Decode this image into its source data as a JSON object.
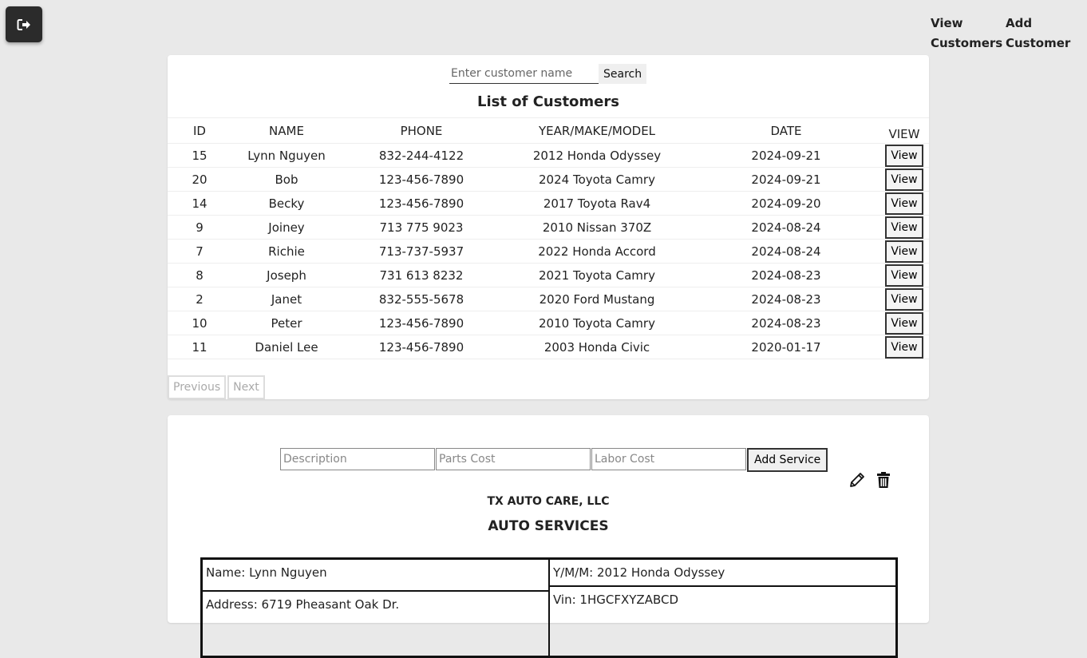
{
  "nav": {
    "view_customers": [
      "View",
      "Customers"
    ],
    "add_customer": [
      "Add",
      "Customer"
    ]
  },
  "search": {
    "placeholder": "Enter customer name",
    "button": "Search"
  },
  "list_title": "List of Customers",
  "table": {
    "headers": [
      "ID",
      "NAME",
      "PHONE",
      "YEAR/MAKE/MODEL",
      "DATE",
      "VIEW"
    ],
    "view_label": "View",
    "rows": [
      {
        "id": "15",
        "name": "Lynn Nguyen",
        "phone": "832-244-4122",
        "vehicle": "2012 Honda Odyssey",
        "date": "2024-09-21"
      },
      {
        "id": "20",
        "name": "Bob",
        "phone": "123-456-7890",
        "vehicle": "2024 Toyota Camry",
        "date": "2024-09-21"
      },
      {
        "id": "14",
        "name": "Becky",
        "phone": "123-456-7890",
        "vehicle": "2017 Toyota Rav4",
        "date": "2024-09-20"
      },
      {
        "id": "9",
        "name": "Joiney",
        "phone": "713 775 9023",
        "vehicle": "2010 Nissan 370Z",
        "date": "2024-08-24"
      },
      {
        "id": "7",
        "name": "Richie",
        "phone": "713-737-5937",
        "vehicle": "2022 Honda Accord",
        "date": "2024-08-24"
      },
      {
        "id": "8",
        "name": "Joseph",
        "phone": "731 613 8232",
        "vehicle": "2021 Toyota Camry",
        "date": "2024-08-23"
      },
      {
        "id": "2",
        "name": "Janet",
        "phone": "832-555-5678",
        "vehicle": "2020 Ford Mustang",
        "date": "2024-08-23"
      },
      {
        "id": "10",
        "name": "Peter",
        "phone": "123-456-7890",
        "vehicle": "2010 Toyota Camry",
        "date": "2024-08-23"
      },
      {
        "id": "11",
        "name": "Daniel Lee",
        "phone": "123-456-7890",
        "vehicle": "2003 Honda Civic",
        "date": "2020-01-17"
      }
    ]
  },
  "pager": {
    "previous": "Previous",
    "next": "Next"
  },
  "service_form": {
    "description_placeholder": "Description",
    "parts_placeholder": "Parts Cost",
    "labor_placeholder": "Labor Cost",
    "add_button": "Add Service"
  },
  "icons": {
    "logout": "logout-icon",
    "edit": "pencil-icon",
    "delete": "trash-icon"
  },
  "company": "TX AUTO CARE, LLC",
  "services_title": "AUTO SERVICES",
  "customer_info": {
    "name": "Name: Lynn Nguyen",
    "address": "Address: 6719 Pheasant Oak Dr.",
    "ymm": "Y/M/M: 2012 Honda Odyssey",
    "vin": "Vin: 1HGCFXYZABCD"
  }
}
